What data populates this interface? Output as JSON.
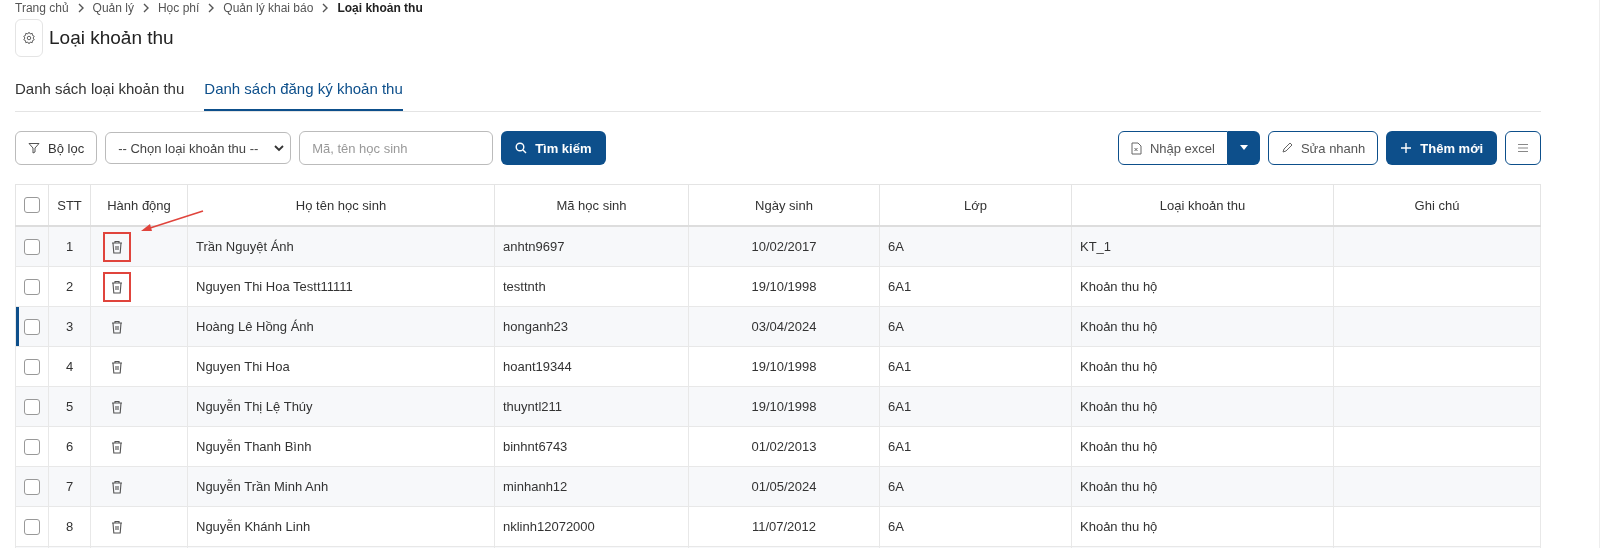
{
  "breadcrumb": [
    "Trang chủ",
    "Quản lý",
    "Học phí",
    "Quản lý khai báo",
    "Loại khoản thu"
  ],
  "title": "Loại khoản thu",
  "tabs": [
    {
      "label": "Danh sách loại khoản thu",
      "selected": false
    },
    {
      "label": "Danh sách đăng ký khoản thu",
      "selected": true
    }
  ],
  "toolbar": {
    "filter_button": "Bộ lọc",
    "select": {
      "value": "-- Chọn loại khoản thu --"
    },
    "search": {
      "placeholder": "Mã, tên học sinh"
    },
    "search_button": "Tìm kiếm",
    "import_button": "Nhập excel",
    "quick_edit_button": "Sửa nhanh",
    "add_button": "Thêm mới"
  },
  "table": {
    "columns": [
      "STT",
      "Hành động",
      "Họ tên học sinh",
      "Mã học sinh",
      "Ngày sinh",
      "Lớp",
      "Loại khoản thu",
      "Ghi chú"
    ],
    "header_checked": false,
    "rows": [
      {
        "checked": false,
        "focused": false,
        "highlighted": true,
        "cells": [
          "1",
          "",
          "Trần Nguyệt Ánh",
          "anhtn9697",
          "10/02/2017",
          "6A",
          "KT_1",
          ""
        ]
      },
      {
        "checked": false,
        "focused": false,
        "highlighted": true,
        "cells": [
          "2",
          "",
          "Nguyen Thi Hoa Testt11111",
          "testtnth",
          "19/10/1998",
          "6A1",
          "Khoản thu hộ",
          ""
        ]
      },
      {
        "checked": false,
        "focused": true,
        "highlighted": false,
        "cells": [
          "3",
          "",
          "Hoàng Lê Hồng Ánh",
          "honganh23",
          "03/04/2024",
          "6A",
          "Khoản thu hộ",
          ""
        ]
      },
      {
        "checked": false,
        "focused": false,
        "highlighted": false,
        "cells": [
          "4",
          "",
          "Nguyen Thi Hoa",
          "hoant19344",
          "19/10/1998",
          "6A1",
          "Khoản thu hộ",
          ""
        ]
      },
      {
        "checked": false,
        "focused": false,
        "highlighted": false,
        "cells": [
          "5",
          "",
          "Nguyễn Thị Lệ Thúy",
          "thuyntl211",
          "19/10/1998",
          "6A1",
          "Khoản thu hộ",
          ""
        ]
      },
      {
        "checked": false,
        "focused": false,
        "highlighted": false,
        "cells": [
          "6",
          "",
          "Nguyễn Thanh Bình",
          "binhnt6743",
          "01/02/2013",
          "6A1",
          "Khoản thu hộ",
          ""
        ]
      },
      {
        "checked": false,
        "focused": false,
        "highlighted": false,
        "cells": [
          "7",
          "",
          "Nguyễn Trần Minh Anh",
          "minhanh12",
          "01/05/2024",
          "6A",
          "Khoản thu hộ",
          ""
        ]
      },
      {
        "checked": false,
        "focused": false,
        "highlighted": false,
        "cells": [
          "8",
          "",
          "Nguyễn Khánh Linh",
          "nklinh12072000",
          "11/07/2012",
          "6A",
          "Khoản thu hộ",
          ""
        ]
      }
    ]
  }
}
